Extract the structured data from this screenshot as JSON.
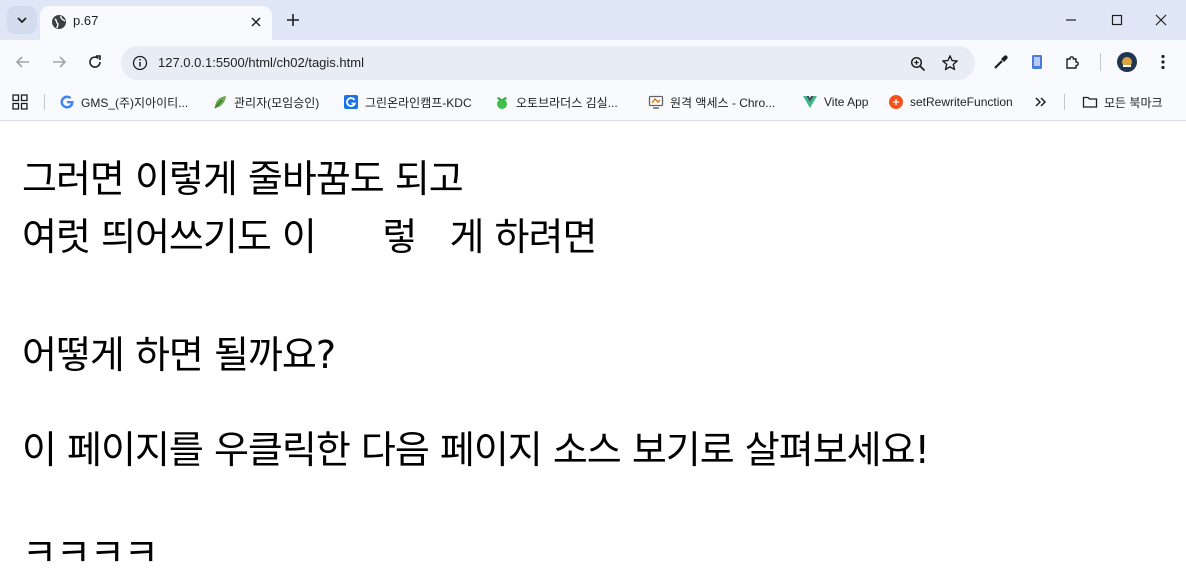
{
  "browser": {
    "tab": {
      "title": "p.67"
    },
    "address": {
      "url": "127.0.0.1:5500/html/ch02/tagis.html"
    },
    "bookmarks": [
      {
        "label": "GMS_(주)지아이티...",
        "icon": "google-g-icon",
        "color": "#4285f4"
      },
      {
        "label": "관리자(모임승인)",
        "icon": "leaf-icon",
        "color": "#4caf50"
      },
      {
        "label": "그린온라인캠프-KDC",
        "icon": "g-square-icon",
        "color": "#1a73e8"
      },
      {
        "label": "오토브라더스 김실...",
        "icon": "sprout-icon",
        "color": "#3ec14b"
      },
      {
        "label": "원격 액세스 - Chro...",
        "icon": "remote-desktop-icon",
        "color": "#e8710a"
      },
      {
        "label": "Vite App",
        "icon": "vue-icon",
        "color": "#41b883"
      },
      {
        "label": "setRewriteFunction",
        "icon": "rewrite-icon",
        "color": "#f4511e"
      }
    ],
    "all_bookmarks_label": "모든 북마크"
  },
  "page": {
    "lines": [
      "그러면 이렇게 줄바꿈도 되고",
      "여럿 띄어쓰기도 이      렇   게 하려면",
      "어떻게 하면 될까요?",
      "이 페이지를 우클릭한 다음 페이지 소스 보기로 살펴보세요!",
      "ㅋㅋㅋㅋ"
    ]
  }
}
